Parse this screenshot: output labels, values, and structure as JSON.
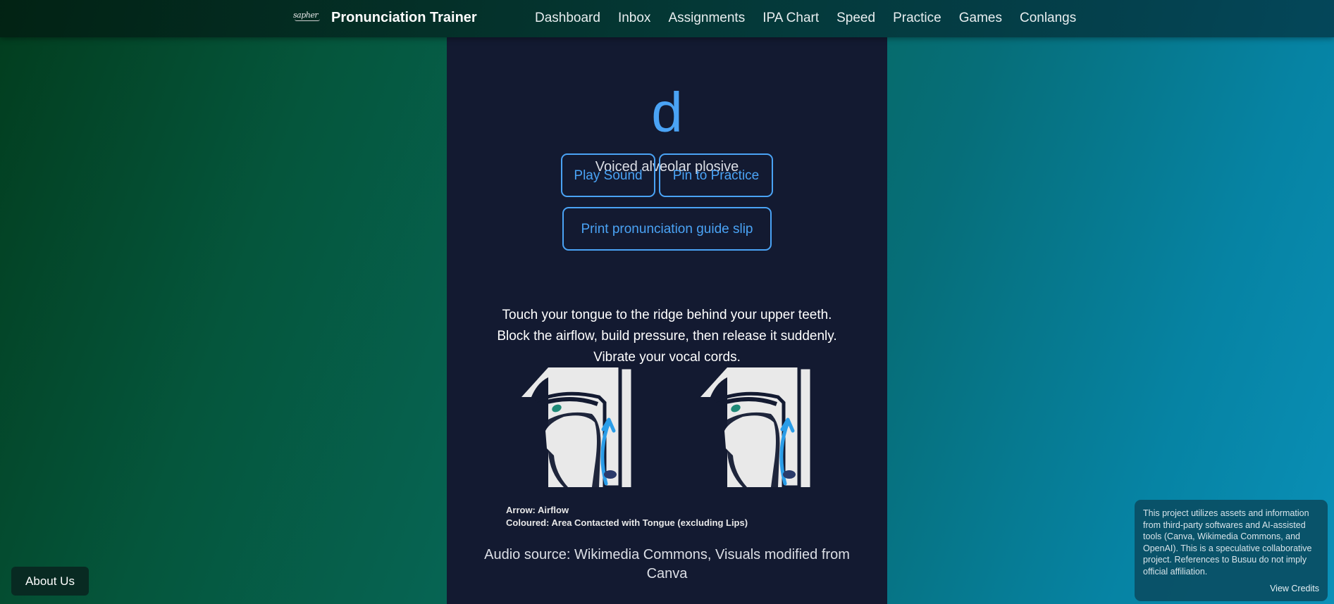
{
  "nav": {
    "logo_text": "sapher",
    "brand": "Pronunciation Trainer",
    "links": [
      "Dashboard",
      "Inbox",
      "Assignments",
      "IPA Chart",
      "Speed",
      "Practice",
      "Games",
      "Conlangs"
    ]
  },
  "phoneme": {
    "symbol": "d",
    "name": "Voiced alveolar plosive"
  },
  "buttons": {
    "play": "Play Sound",
    "pin": "Pin to Practice",
    "print": "Print pronunciation guide slip"
  },
  "description": {
    "line1": "Touch your tongue to the ridge behind your upper teeth.",
    "line2": "Block the airflow, build pressure, then release it suddenly.",
    "line3": "Vibrate your vocal cords."
  },
  "legend": {
    "arrow": "Arrow: Airflow",
    "coloured": "Coloured: Area Contacted with Tongue (excluding Lips)"
  },
  "audio_source": "Audio source: Wikimedia Commons, Visuals modified from Canva",
  "about_button": "About Us",
  "credits": {
    "text": "This project utilizes assets and information from third-party softwares and AI-assisted tools (Canva, Wikimedia Commons, and OpenAI). This is a speculative collaborative project. References to Busuu do not imply official affiliation.",
    "link": "View Credits"
  },
  "colors": {
    "accent": "#4aa3f5",
    "panel": "#131a31",
    "contact_area": "#1f8a78",
    "airflow_arrow": "#2a9de8"
  },
  "icons": {
    "diagram_left": "mouth-cross-section",
    "diagram_right": "mouth-cross-section"
  }
}
